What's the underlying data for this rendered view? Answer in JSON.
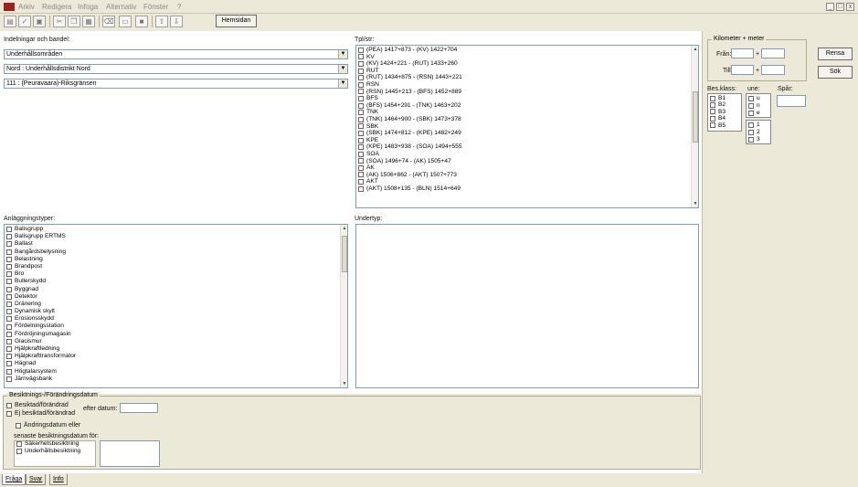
{
  "menu": [
    "Arkiv",
    "Redigera",
    "Infoga",
    "Alternativ",
    "Fönster",
    "?"
  ],
  "window_buttons": [
    "_",
    "□",
    "x"
  ],
  "toolbar": {
    "hemsidan_label": "Hemsidan"
  },
  "left": {
    "indelningar_label": "Indelningar och bandel:",
    "combo1": "Underhållsområden",
    "combo2": "Nord : Underhållsdistrikt Nord",
    "combo3": "111 : (Peuravaara)-Riksgränsen",
    "anlaggning_label": "Anläggningstyper:",
    "anlaggning_items": [
      "Balisgrupp",
      "Balisgrupp ERTMS",
      "Ballast",
      "Bangårdsbelysning",
      "Belastning",
      "Brandpost",
      "Bro",
      "Bullerskydd",
      "Byggnad",
      "Detektor",
      "Dränering",
      "Dynamisk skylt",
      "Erosionsskydd",
      "Fördelningsstation",
      "Fördröjningsmagasin",
      "Glacismur",
      "Hjälpkraftledning",
      "Hjälpkrafttransformator",
      "Hägnad",
      "Högtalarsystem",
      "Järnvägsbank"
    ]
  },
  "middle": {
    "tpl_label": "Tpl/str:",
    "tpl_items": [
      "(PEA) 1417+873 - (KV) 1422+704",
      "KV",
      "(KV) 1424+221 - (RUT) 1433+260",
      "RUT",
      "(RUT) 1434+875 - (RSN) 1443+221",
      "RSN",
      "(RSN) 1445+213 - (BFS) 1452+889",
      "BFS",
      "(BFS) 1454+291 - (TNK) 1463+202",
      "TNK",
      "(TNK) 1464+900 - (SBK) 1473+378",
      "SBK",
      "(SBK) 1474+812 - (KPE) 1482+249",
      "KPE",
      "(KPE) 1483+938 - (SOA) 1494+555",
      "SOA",
      "(SOA) 1496+74 - (AK) 1505+47",
      "AK",
      "(AK) 1506+862 - (AKT) 1507+773",
      "AKT",
      "(AKT) 1508+135 - (BLN) 1514+649"
    ],
    "undertyp_label": "Undertyp:"
  },
  "bottom": {
    "group_title": "Besiktnings-/Förändringsdatum",
    "besiktad": "Besiktad/förändrad",
    "ej_besiktad": "Ej besiktad/förändrad",
    "efter_datum": "efter datum:",
    "andringsdatum": "Ändringsdatum eller",
    "senaste": "senaste besiktningsdatum för:",
    "sakerhet": "Säkerhetsbesiktning",
    "underhall": "Underhållsbesiktning"
  },
  "right": {
    "km_title": "Kilometer + meter",
    "fran": "Från:",
    "till": "Till:",
    "plus": "+",
    "rensa": "Rensa",
    "sok": "Sök",
    "bes_klass": "Bes.klass:",
    "une": "une:",
    "spar": "Spår:",
    "bes_items": [
      "B1",
      "B2",
      "B3",
      "B4",
      "B5"
    ],
    "une_items": [
      "u",
      "n",
      "e"
    ],
    "num_items": [
      "1",
      "2",
      "3"
    ]
  },
  "tabs": [
    "Fråga",
    "Svar",
    "Info"
  ]
}
